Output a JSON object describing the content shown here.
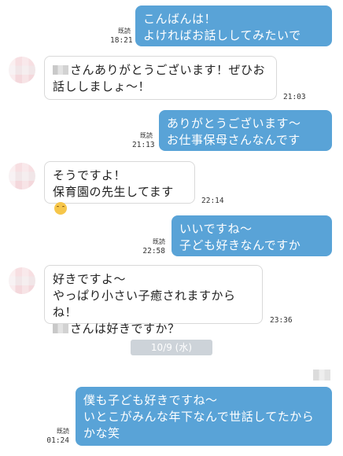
{
  "messages": [
    {
      "side": "out",
      "text": "こんばんは！\nよければお話ししてみたいです〜",
      "read": "既読",
      "time": "18:21"
    },
    {
      "side": "in",
      "prefix_masked": true,
      "text": "さんありがとうございます！ぜひお話ししましょ〜！",
      "time": "21:03"
    },
    {
      "side": "out",
      "text": "ありがとうございます〜\nお仕事保母さんなんですか？",
      "read": "既読",
      "time": "21:13"
    },
    {
      "side": "in",
      "text_line1": "そうですよ！",
      "text_line2": "保育園の先生してます",
      "emoji": "relieved-face",
      "time": "22:14"
    },
    {
      "side": "out",
      "text": "いいですね〜\n子ども好きなんですかー？",
      "read": "既読",
      "time": "22:58"
    },
    {
      "side": "in",
      "text_line1": "好きですよ〜",
      "text_line2": "やっぱり小さい子癒されますからね！",
      "text_line3": "さんは好きですか？",
      "prefix_masked_line3": true,
      "time": "23:36"
    },
    {
      "side": "out",
      "text": "僕も子ども好きですね〜\nいとこがみんな年下なんで世話してたからかな笑",
      "read": "既読",
      "time": "01:24"
    }
  ],
  "date_separator": "10/9 (水)"
}
